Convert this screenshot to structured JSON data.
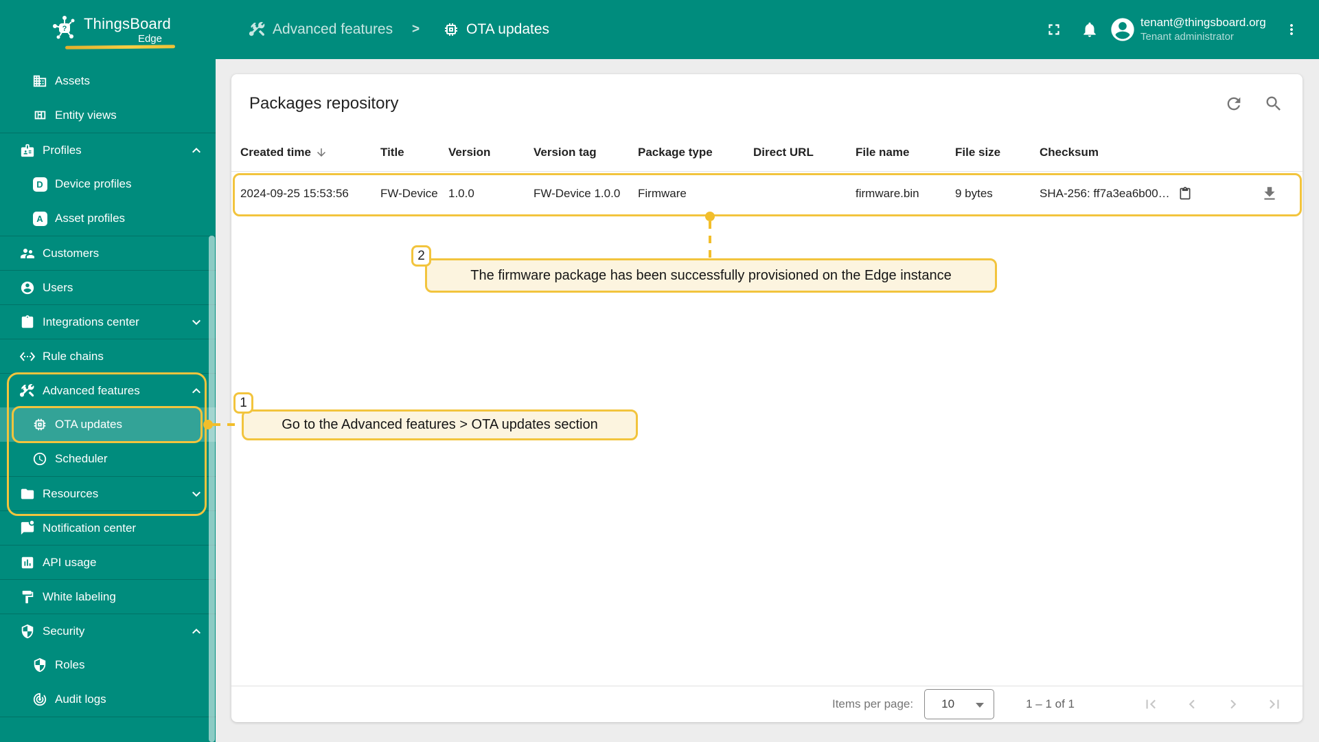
{
  "brand": {
    "name": "ThingsBoard",
    "edition": "Edge"
  },
  "header": {
    "breadcrumb": {
      "parent": "Advanced features",
      "separator": ">",
      "current": "OTA updates"
    },
    "user": {
      "email": "tenant@thingsboard.org",
      "role": "Tenant administrator"
    }
  },
  "sidebar": {
    "items": [
      {
        "label": "Assets",
        "icon": "domain"
      },
      {
        "label": "Entity views",
        "icon": "view-quilt"
      },
      {
        "label": "Profiles",
        "icon": "badge",
        "expand": "up"
      },
      {
        "label": "Device profiles",
        "icon": "letter-d"
      },
      {
        "label": "Asset profiles",
        "icon": "letter-a"
      },
      {
        "label": "Customers",
        "icon": "supervisor-account"
      },
      {
        "label": "Users",
        "icon": "account-circle"
      },
      {
        "label": "Integrations center",
        "icon": "integration-instructions",
        "expand": "down"
      },
      {
        "label": "Rule chains",
        "icon": "settings-ethernet"
      },
      {
        "label": "Advanced features",
        "icon": "construction",
        "expand": "up"
      },
      {
        "label": "OTA updates",
        "icon": "memory",
        "active": true
      },
      {
        "label": "Scheduler",
        "icon": "schedule"
      },
      {
        "label": "Resources",
        "icon": "folder",
        "expand": "down"
      },
      {
        "label": "Notification center",
        "icon": "chat-unread"
      },
      {
        "label": "API usage",
        "icon": "insert-chart"
      },
      {
        "label": "White labeling",
        "icon": "format-paint"
      },
      {
        "label": "Security",
        "icon": "shield",
        "expand": "up"
      },
      {
        "label": "Roles",
        "icon": "shield"
      },
      {
        "label": "Audit logs",
        "icon": "track-changes"
      }
    ]
  },
  "page": {
    "title": "Packages repository"
  },
  "table": {
    "columns": [
      "Created time",
      "Title",
      "Version",
      "Version tag",
      "Package type",
      "Direct URL",
      "File name",
      "File size",
      "Checksum"
    ],
    "rows": [
      {
        "created_time": "2024-09-25 15:53:56",
        "title": "FW-Device",
        "version": "1.0.0",
        "version_tag": "FW-Device 1.0.0",
        "package_type": "Firmware",
        "direct_url": "",
        "file_name": "firmware.bin",
        "file_size": "9 bytes",
        "checksum": "SHA-256: ff7a3ea6b00…"
      }
    ]
  },
  "pagination": {
    "items_per_page_label": "Items per page:",
    "items_per_page": "10",
    "range": "1 – 1 of 1"
  },
  "annotations": {
    "step1": {
      "number": "1",
      "text": "Go to the Advanced features > OTA updates section"
    },
    "step2": {
      "number": "2",
      "text": "The firmware package has been successfully provisioned on the Edge instance"
    }
  },
  "colors": {
    "primary": "#008C7D",
    "highlight": "#F2C43D",
    "callout_bg": "#FCF4DF",
    "page_bg": "#EDEDED"
  }
}
